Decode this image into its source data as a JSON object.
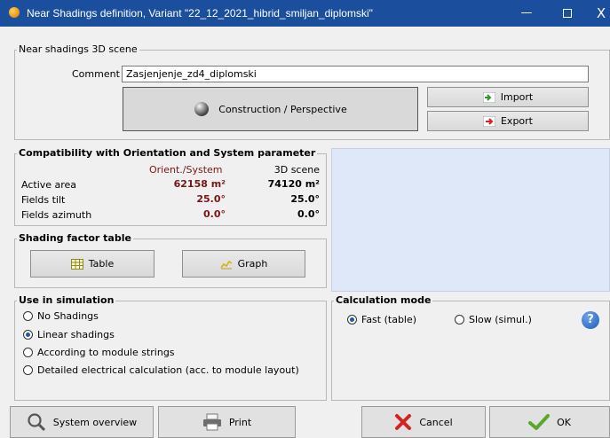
{
  "window": {
    "title": "Near Shadings definition, Variant \"22_12_2021_hibrid_smiljan_diplomski\"",
    "minimize": "—",
    "close": "X"
  },
  "scene": {
    "legend": "Near shadings 3D scene",
    "comment_label": "Comment",
    "comment_value": "Zasjenjenje_zd4_diplomski",
    "construction_button": "Construction / Perspective",
    "import_button": "Import",
    "export_button": "Export"
  },
  "compat": {
    "legend": "Compatibility with Orientation and System parameter",
    "col_orient": "Orient./System",
    "col_scene": "3D scene",
    "rows": [
      {
        "label": "Active area",
        "orient": "62158 m²",
        "scene": "74120 m²"
      },
      {
        "label": "Fields tilt",
        "orient": "25.0°",
        "scene": "25.0°"
      },
      {
        "label": "Fields azimuth",
        "orient": "0.0°",
        "scene": "0.0°"
      }
    ]
  },
  "shading": {
    "legend": "Shading factor table",
    "table_button": "Table",
    "graph_button": "Graph"
  },
  "simulation": {
    "legend": "Use in simulation",
    "options": [
      "No Shadings",
      "Linear shadings",
      "According to module strings",
      "Detailed electrical calculation (acc. to module layout)"
    ],
    "selected": 1
  },
  "calc": {
    "legend": "Calculation mode",
    "fast": "Fast (table)",
    "slow": "Slow (simul.)",
    "selected": "fast",
    "help": "?"
  },
  "footer": {
    "system_overview": "System overview",
    "print": "Print",
    "cancel": "Cancel",
    "ok": "OK"
  },
  "colors": {
    "titlebar": "#1b4f9e",
    "value_red": "#7a1416",
    "preview_bg": "#dfe8f8",
    "check_green": "#5aa82a",
    "cancel_red": "#d32424"
  }
}
